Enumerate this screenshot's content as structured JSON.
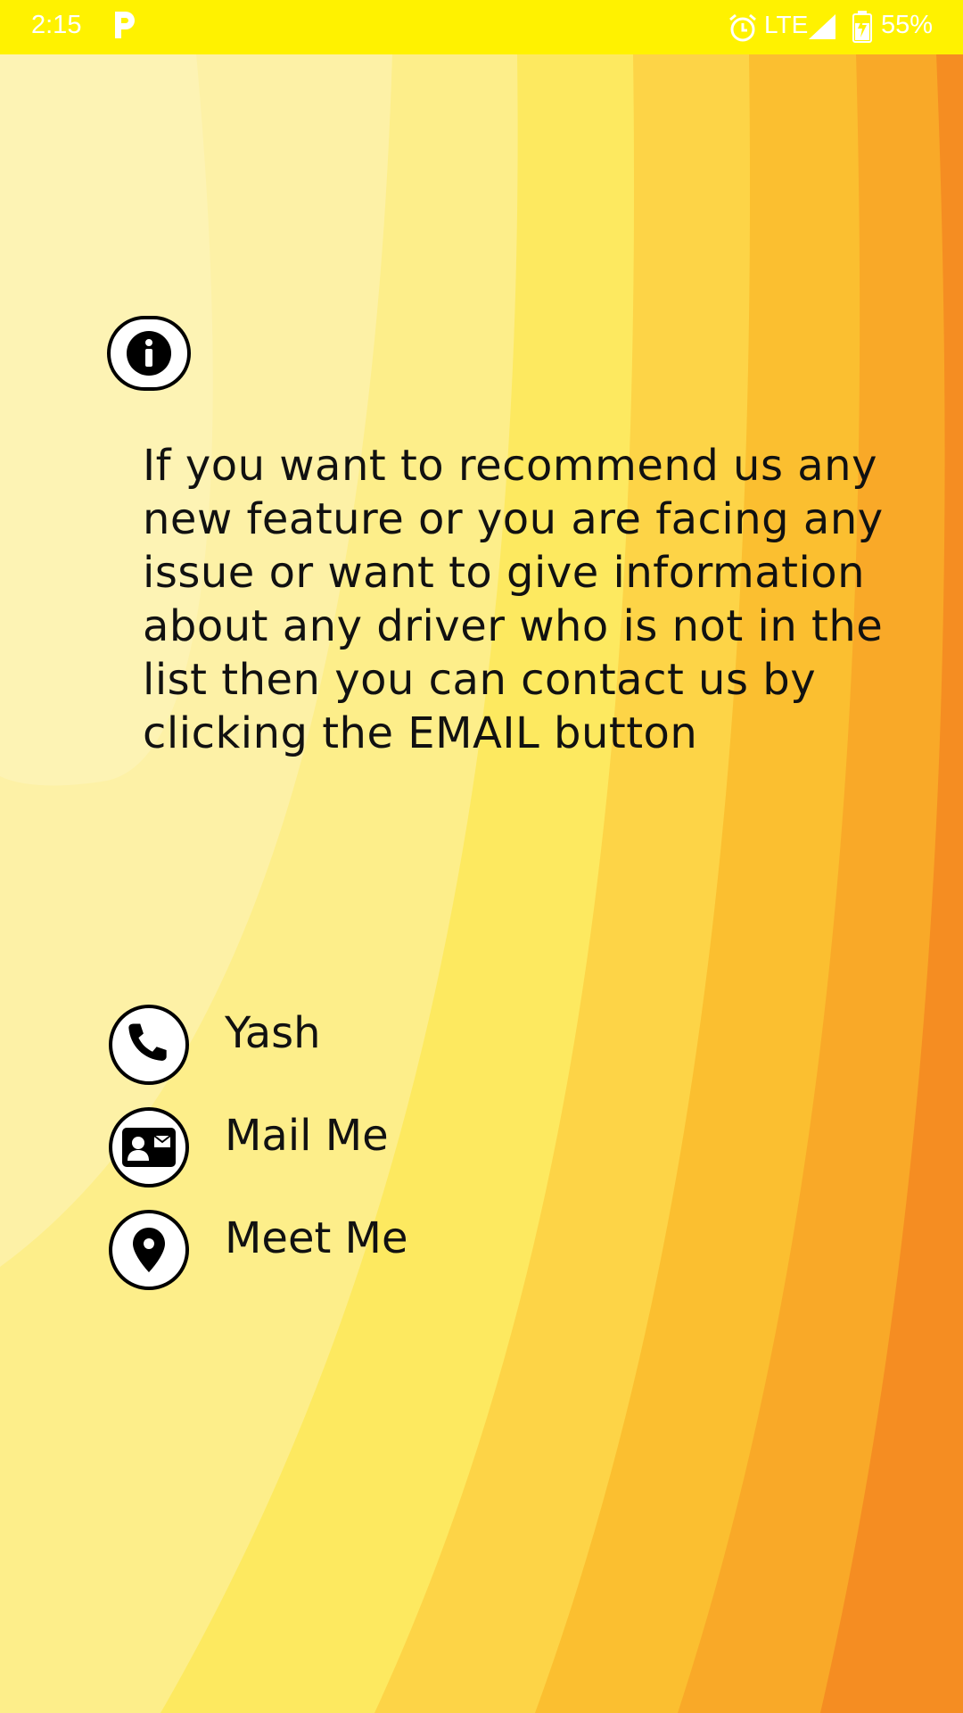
{
  "status_bar": {
    "time": "2:15",
    "network": "LTE",
    "battery": "55%",
    "icons": [
      "p-app-icon",
      "alarm-icon",
      "signal-icon",
      "battery-icon"
    ]
  },
  "info": {
    "icon": "info-icon",
    "message": "If you want to recommend us any new feature or you are facing any issue or want to give information about any driver who is not in the list then you can contact us by clicking the EMAIL button"
  },
  "contacts": [
    {
      "icon": "phone-icon",
      "label": "Yash"
    },
    {
      "icon": "contact-card-icon",
      "label": "Mail Me"
    },
    {
      "icon": "location-pin-icon",
      "label": "Meet Me"
    }
  ],
  "colors": {
    "status_bar": "#fff200",
    "bg_light": "#fef8c0",
    "bg_yellow": "#fde950",
    "bg_orange": "#f7931e",
    "bg_deep_orange": "#f47c20",
    "text": "#111111"
  }
}
